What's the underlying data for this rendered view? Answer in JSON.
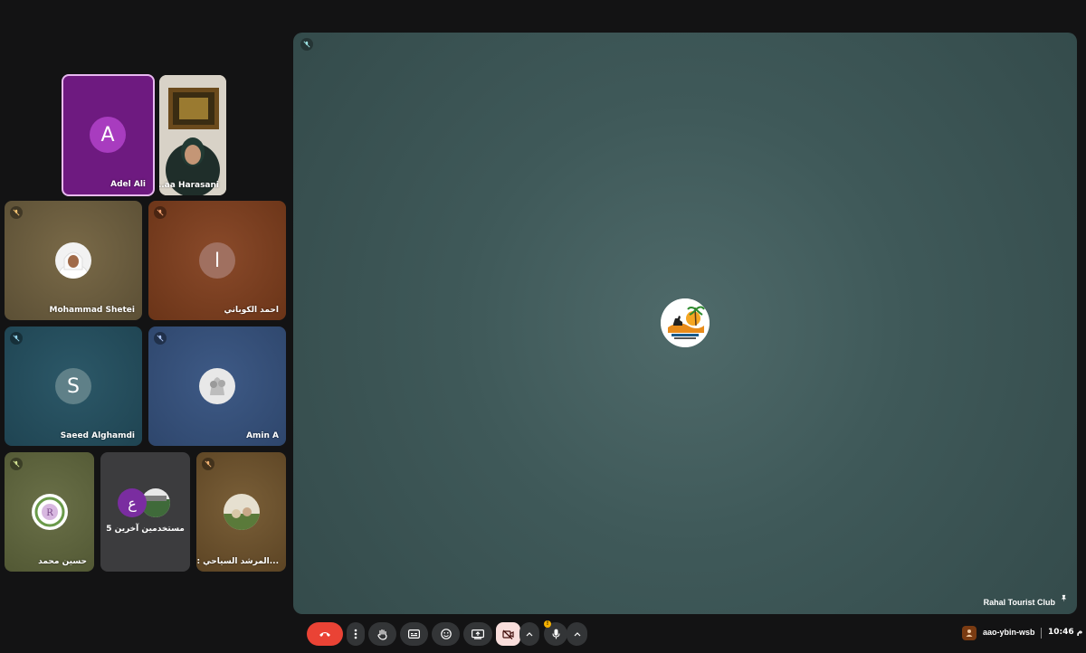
{
  "participants": {
    "adel": {
      "name": "Adel Ali",
      "initial": "A"
    },
    "harasani": {
      "name": "...aa Harasani"
    },
    "mohammad": {
      "name": "Mohammad Shetei"
    },
    "ahmad": {
      "name": "احمد الكوباني",
      "initial": "ا"
    },
    "saeed": {
      "name": "Saeed Alghamdi",
      "initial": "S"
    },
    "amin": {
      "name": "Amin A"
    },
    "hassan": {
      "name": "حسين محمد"
    },
    "others": {
      "label": "5 مستخدمين آخرين",
      "initial": "ع"
    },
    "guide": {
      "name": "المرشد السياحي : عبدالمحـ..."
    }
  },
  "stage": {
    "name": "Rahal Tourist Club"
  },
  "footer": {
    "meeting_code": "aao-ybin-wsb",
    "time": "10:46 م"
  },
  "colors": {
    "hangup": "#ea4335",
    "camera_off_bg": "#f9dedc",
    "control_bg": "#333537",
    "warning": "#f6b100"
  },
  "icons": [
    "mic-off-icon",
    "hangup-icon",
    "more-vert-icon",
    "raise-hand-icon",
    "captions-icon",
    "emoji-icon",
    "present-icon",
    "camera-off-icon",
    "chevron-up-icon",
    "mic-icon",
    "pin-icon",
    "host-icon",
    "warning-icon"
  ]
}
